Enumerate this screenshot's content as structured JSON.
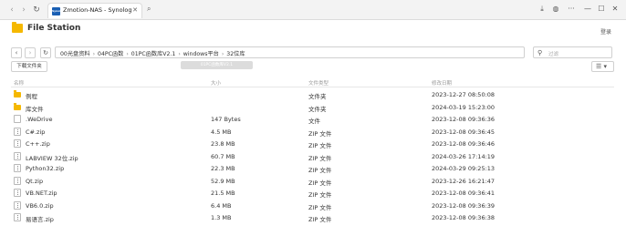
{
  "browser": {
    "tab_title": "Zmotion-NAS - Synology N",
    "tab_favicon_text": "Synology",
    "close_glyph": "✕",
    "nav": {
      "back": "‹",
      "forward": "›",
      "reload": "↻",
      "search": "⌕"
    },
    "window": {
      "download": "⤓",
      "globe": "◍",
      "more": "···",
      "minimize": "—",
      "maximize": "☐",
      "close": "✕"
    }
  },
  "app": {
    "title": "File Station",
    "logout_label": "登录"
  },
  "toolbar": {
    "back": "‹",
    "forward": "›",
    "refresh": "↻",
    "breadcrumb": [
      "00光盘资料",
      "04PC函数",
      "01PC函数库V2.1",
      "windows平台",
      "32位库"
    ],
    "breadcrumb_sep": "›",
    "filter_icon": "⚲",
    "filter_placeholder": "过滤",
    "upload_label": "下载文件夹",
    "disabled_hint": "01PC函数库V2.1",
    "view_icon": "☰ ▾"
  },
  "table": {
    "headers": {
      "name": "名称",
      "size": "大小",
      "type": "文件类型",
      "modified": "修改日期"
    },
    "rows": [
      {
        "icon": "folder",
        "name": "例程",
        "size": "",
        "type": "文件夹",
        "modified": "2023-12-27 08:50:08"
      },
      {
        "icon": "folder",
        "name": "库文件",
        "size": "",
        "type": "文件夹",
        "modified": "2024-03-19 15:23:00"
      },
      {
        "icon": "file",
        "name": ".WeDrive",
        "size": "147 Bytes",
        "type": "文件",
        "modified": "2023-12-08 09:36:36"
      },
      {
        "icon": "zip",
        "name": "C#.zip",
        "size": "4.5 MB",
        "type": "ZIP 文件",
        "modified": "2023-12-08 09:36:45"
      },
      {
        "icon": "zip",
        "name": "C++.zip",
        "size": "23.8 MB",
        "type": "ZIP 文件",
        "modified": "2023-12-08 09:36:46"
      },
      {
        "icon": "zip",
        "name": "LABVIEW 32位.zip",
        "size": "60.7 MB",
        "type": "ZIP 文件",
        "modified": "2024-03-26 17:14:19"
      },
      {
        "icon": "zip",
        "name": "Python32.zip",
        "size": "22.3 MB",
        "type": "ZIP 文件",
        "modified": "2024-03-29 09:25:13"
      },
      {
        "icon": "zip",
        "name": "Qt.zip",
        "size": "52.9 MB",
        "type": "ZIP 文件",
        "modified": "2023-12-26 16:21:47"
      },
      {
        "icon": "zip",
        "name": "VB.NET.zip",
        "size": "21.5 MB",
        "type": "ZIP 文件",
        "modified": "2023-12-08 09:36:41"
      },
      {
        "icon": "zip",
        "name": "VB6.0.zip",
        "size": "6.4 MB",
        "type": "ZIP 文件",
        "modified": "2023-12-08 09:36:39"
      },
      {
        "icon": "zip",
        "name": "易语言.zip",
        "size": "1.3 MB",
        "type": "ZIP 文件",
        "modified": "2023-12-08 09:36:38"
      }
    ]
  }
}
